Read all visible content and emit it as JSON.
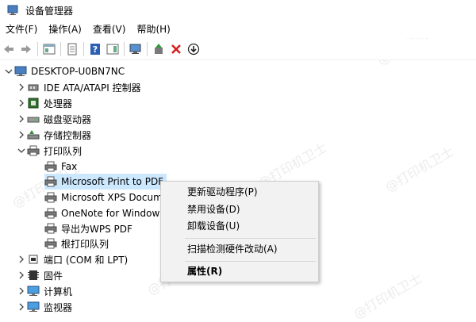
{
  "window": {
    "title": "设备管理器"
  },
  "menu": [
    "文件(F)",
    "操作(A)",
    "查看(V)",
    "帮助(H)"
  ],
  "tree": {
    "root": "DESKTOP-U0BN7NC",
    "items": [
      {
        "label": "IDE ATA/ATAPI 控制器",
        "icon": "ide-controller-icon"
      },
      {
        "label": "处理器",
        "icon": "processor-icon"
      },
      {
        "label": "磁盘驱动器",
        "icon": "disk-drive-icon"
      },
      {
        "label": "存储控制器",
        "icon": "storage-controller-icon"
      },
      {
        "label": "打印队列",
        "icon": "printer-icon"
      },
      {
        "label": "Fax",
        "icon": "printer-icon"
      },
      {
        "label": "Microsoft Print to PDF",
        "icon": "printer-icon"
      },
      {
        "label": "Microsoft XPS Docum",
        "icon": "printer-icon"
      },
      {
        "label": "OneNote for Window",
        "icon": "printer-icon"
      },
      {
        "label": "导出为WPS PDF",
        "icon": "printer-icon"
      },
      {
        "label": "根打印队列",
        "icon": "printer-icon"
      },
      {
        "label": "端口 (COM 和 LPT)",
        "icon": "port-icon"
      },
      {
        "label": "固件",
        "icon": "firmware-icon"
      },
      {
        "label": "计算机",
        "icon": "computer-icon"
      },
      {
        "label": "监视器",
        "icon": "monitor-icon"
      }
    ]
  },
  "context_menu": {
    "items": [
      "更新驱动程序(P)",
      "禁用设备(D)",
      "卸载设备(U)",
      "扫描检测硬件改动(A)",
      "属性(R)"
    ]
  },
  "watermark": "@打印机卫士"
}
